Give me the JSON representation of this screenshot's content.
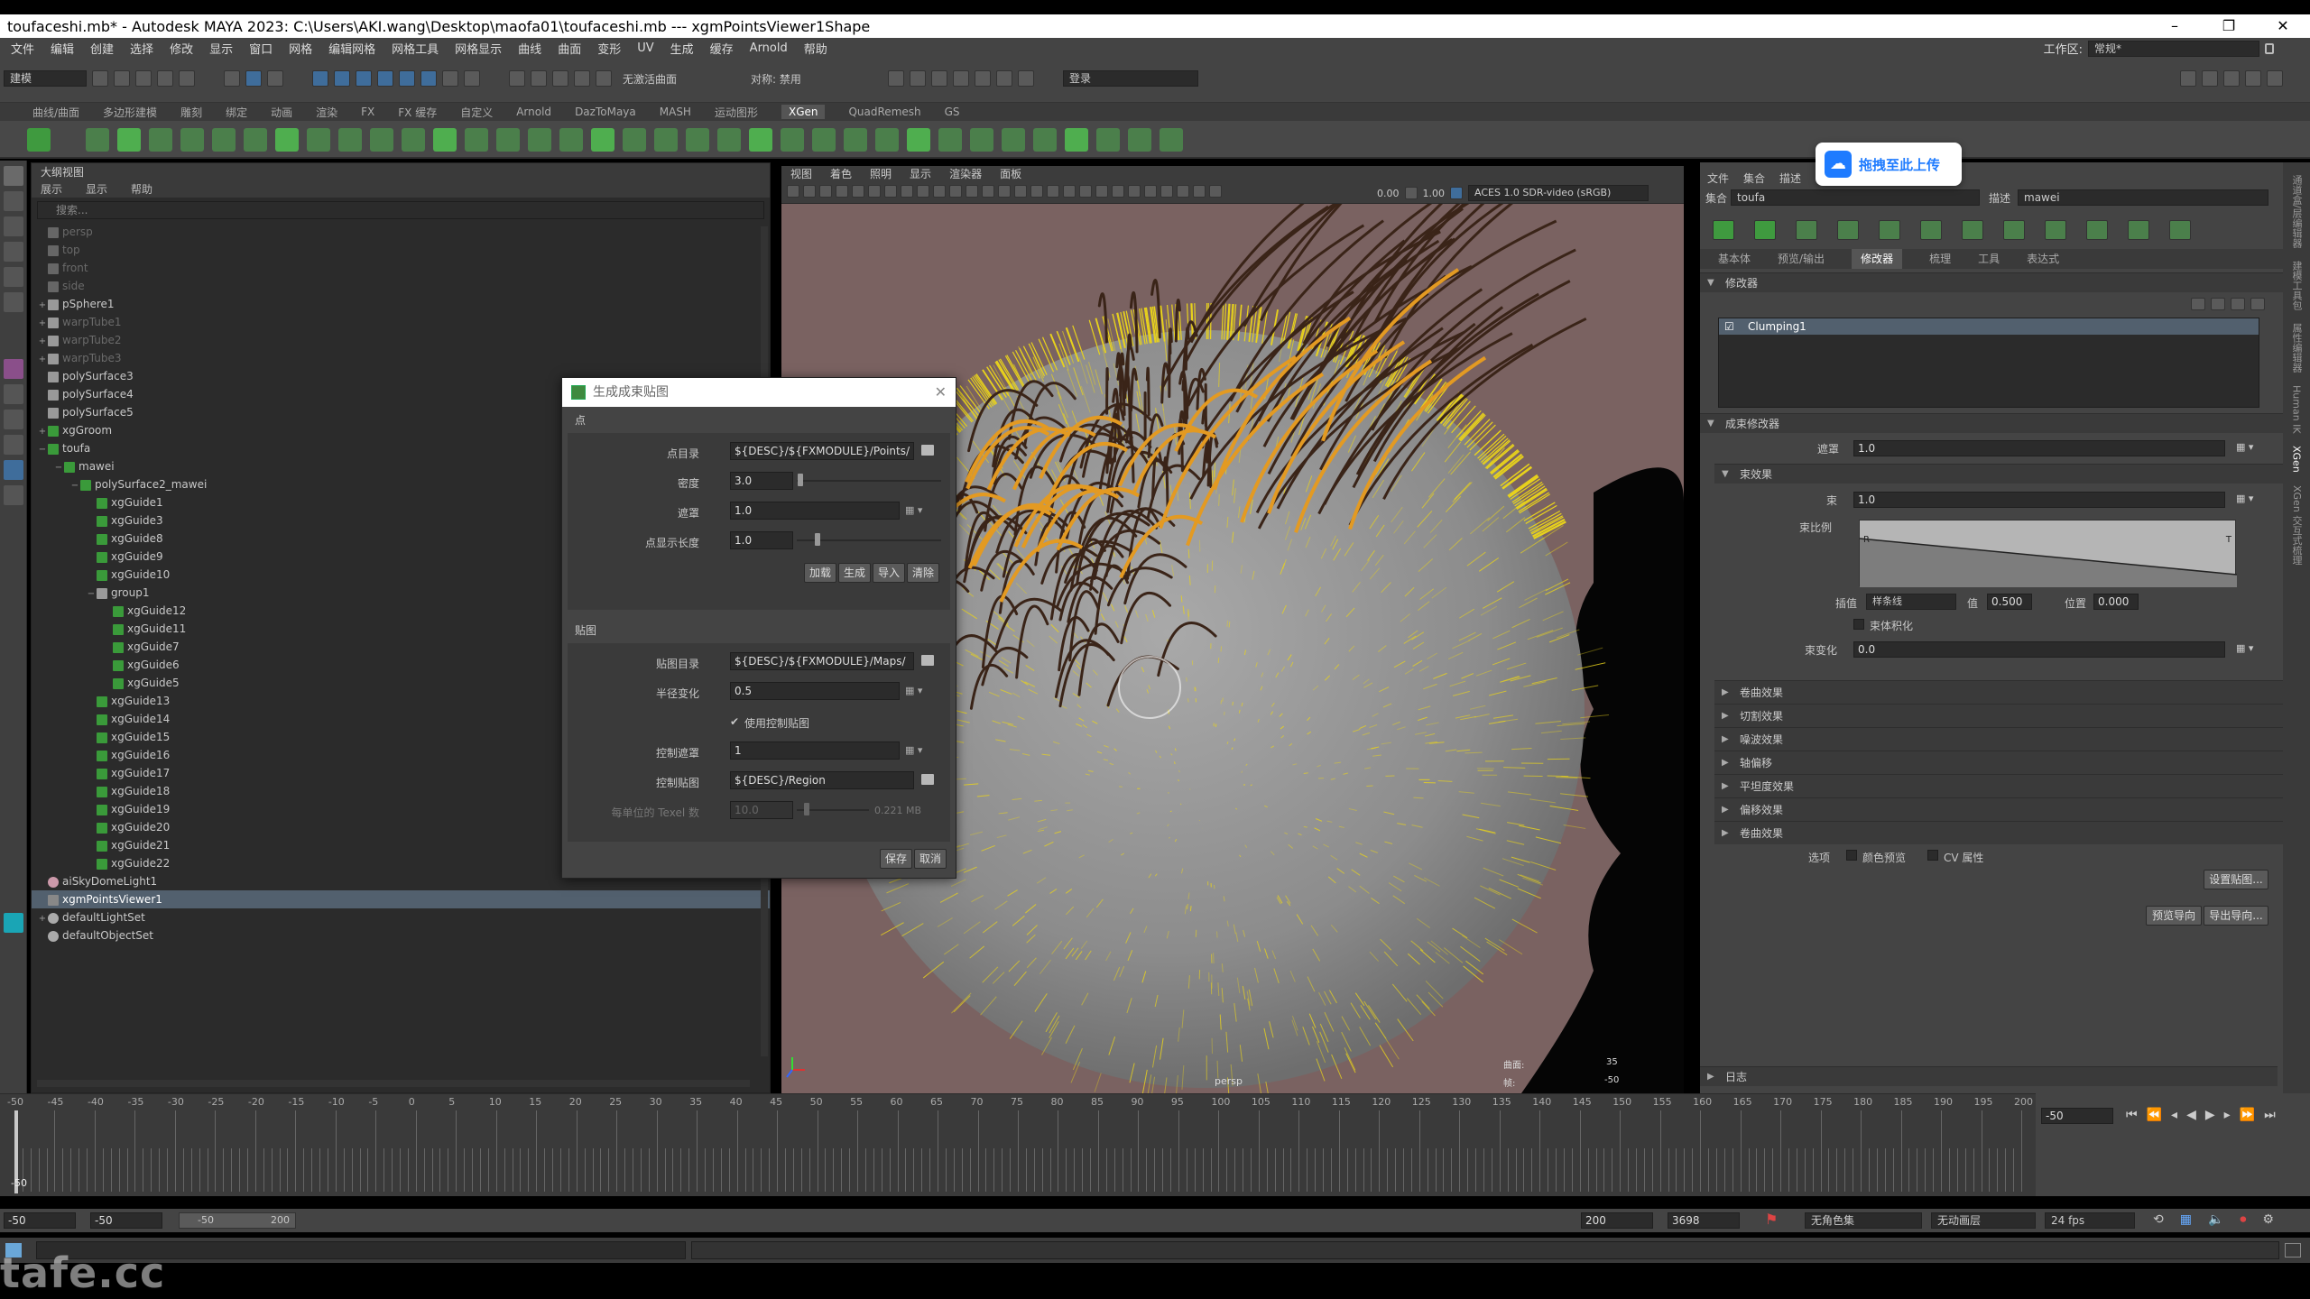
{
  "window": {
    "title": "toufaceshi.mb* - Autodesk MAYA 2023: C:\\Users\\AKI.wang\\Desktop\\maofa01\\toufaceshi.mb   ---   xgmPointsViewer1Shape",
    "minimize": "–",
    "maximize": "❐",
    "close": "✕"
  },
  "menubar": {
    "items": [
      "文件",
      "编辑",
      "创建",
      "选择",
      "修改",
      "显示",
      "窗口",
      "网格",
      "编辑网格",
      "网格工具",
      "网格显示",
      "曲线",
      "曲面",
      "变形",
      "UV",
      "生成",
      "缓存",
      "Arnold",
      "帮助"
    ],
    "workspace_label": "工作区:",
    "workspace_value": "常规*"
  },
  "statusline": {
    "mode": "建模",
    "no_live_surface": "无激活曲面",
    "symmetry": "对称: 禁用",
    "login": "登录"
  },
  "shelf": {
    "tabs": [
      "曲线/曲面",
      "多边形建模",
      "雕刻",
      "绑定",
      "动画",
      "渲染",
      "FX",
      "FX 缓存",
      "自定义",
      "Arnold",
      "DazToMaya",
      "MASH",
      "运动图形",
      "XGen",
      "QuadRemesh",
      "GS"
    ],
    "active_tab": "XGen"
  },
  "outliner": {
    "title": "大纲视图",
    "menu": [
      "展示",
      "显示",
      "帮助"
    ],
    "search_placeholder": "搜索...",
    "rows": [
      {
        "label": "persp",
        "indent": 1,
        "dim": true,
        "icon": "camera"
      },
      {
        "label": "top",
        "indent": 1,
        "dim": true,
        "icon": "camera"
      },
      {
        "label": "front",
        "indent": 1,
        "dim": true,
        "icon": "camera"
      },
      {
        "label": "side",
        "indent": 1,
        "dim": true,
        "icon": "camera"
      },
      {
        "label": "pSphere1",
        "indent": 1,
        "exp": "+",
        "icon": "mesh"
      },
      {
        "label": "warpTube1",
        "indent": 1,
        "exp": "+",
        "dim": true,
        "icon": "mesh"
      },
      {
        "label": "warpTube2",
        "indent": 1,
        "exp": "+",
        "dim": true,
        "icon": "mesh"
      },
      {
        "label": "warpTube3",
        "indent": 1,
        "exp": "+",
        "dim": true,
        "icon": "mesh"
      },
      {
        "label": "polySurface3",
        "indent": 1,
        "icon": "mesh"
      },
      {
        "label": "polySurface4",
        "indent": 1,
        "icon": "mesh"
      },
      {
        "label": "polySurface5",
        "indent": 1,
        "icon": "mesh"
      },
      {
        "label": "xgGroom",
        "indent": 1,
        "exp": "+",
        "icon": "xgen"
      },
      {
        "label": "toufa",
        "indent": 1,
        "exp": "−",
        "icon": "xgen"
      },
      {
        "label": "mawei",
        "indent": 2,
        "exp": "−",
        "icon": "xgen"
      },
      {
        "label": "polySurface2_mawei",
        "indent": 3,
        "exp": "−",
        "icon": "grid"
      },
      {
        "label": "xgGuide1",
        "indent": 4,
        "icon": "guide"
      },
      {
        "label": "xgGuide3",
        "indent": 4,
        "icon": "guide"
      },
      {
        "label": "xgGuide8",
        "indent": 4,
        "icon": "guide"
      },
      {
        "label": "xgGuide9",
        "indent": 4,
        "icon": "guide"
      },
      {
        "label": "xgGuide10",
        "indent": 4,
        "icon": "guide"
      },
      {
        "label": "group1",
        "indent": 4,
        "exp": "−",
        "icon": "group"
      },
      {
        "label": "xgGuide12",
        "indent": 5,
        "icon": "guide"
      },
      {
        "label": "xgGuide11",
        "indent": 5,
        "icon": "guide"
      },
      {
        "label": "xgGuide7",
        "indent": 5,
        "icon": "guide"
      },
      {
        "label": "xgGuide6",
        "indent": 5,
        "icon": "guide"
      },
      {
        "label": "xgGuide5",
        "indent": 5,
        "icon": "guide"
      },
      {
        "label": "xgGuide13",
        "indent": 4,
        "icon": "guide"
      },
      {
        "label": "xgGuide14",
        "indent": 4,
        "icon": "guide"
      },
      {
        "label": "xgGuide15",
        "indent": 4,
        "icon": "guide"
      },
      {
        "label": "xgGuide16",
        "indent": 4,
        "icon": "guide"
      },
      {
        "label": "xgGuide17",
        "indent": 4,
        "icon": "guide"
      },
      {
        "label": "xgGuide18",
        "indent": 4,
        "icon": "guide"
      },
      {
        "label": "xgGuide19",
        "indent": 4,
        "icon": "guide"
      },
      {
        "label": "xgGuide20",
        "indent": 4,
        "icon": "guide"
      },
      {
        "label": "xgGuide21",
        "indent": 4,
        "icon": "guide"
      },
      {
        "label": "xgGuide22",
        "indent": 4,
        "icon": "guide"
      },
      {
        "label": "aiSkyDomeLight1",
        "indent": 1,
        "icon": "light"
      },
      {
        "label": "xgmPointsViewer1",
        "indent": 1,
        "selected": true,
        "icon": "points"
      },
      {
        "label": "defaultLightSet",
        "indent": 1,
        "exp": "+",
        "icon": "set"
      },
      {
        "label": "defaultObjectSet",
        "indent": 1,
        "icon": "set"
      }
    ]
  },
  "viewport": {
    "menu": [
      "视图",
      "着色",
      "照明",
      "显示",
      "渲染器",
      "面板"
    ],
    "exposure": "0.00",
    "gamma": "1.00",
    "color_space": "ACES 1.0 SDR-video (sRGB)",
    "camera_label": "persp",
    "hud_left_label": "曲面:",
    "hud_left_value": "35",
    "hud_right_label": "帧:",
    "hud_right_value": "-50"
  },
  "dialog": {
    "title": "生成成束贴图",
    "close": "✕",
    "points_section": "点",
    "maps_section": "贴图",
    "point_dir_label": "点目录",
    "point_dir_value": "${DESC}/${FXMODULE}/Points/",
    "density_label": "密度",
    "density_value": "3.0",
    "mask_label": "遮罩",
    "mask_value": "1.0",
    "point_display_label": "点显示长度",
    "point_display_value": "1.0",
    "btn_load": "加载",
    "btn_generate": "生成",
    "btn_import": "导入",
    "btn_clear": "清除",
    "map_dir_label": "贴图目录",
    "map_dir_value": "${DESC}/${FXMODULE}/Maps/",
    "radius_var_label": "半径变化",
    "radius_var_value": "0.5",
    "use_control_map": "使用控制贴图",
    "control_mask_label": "控制遮罩",
    "control_mask_value": "1",
    "control_map_label": "控制贴图",
    "control_map_value": "${DESC}/Region",
    "texel_label": "每单位的 Texel 数",
    "texel_value": "10.0",
    "texel_size": "0.221 MB",
    "btn_save": "保存",
    "btn_cancel": "取消"
  },
  "upload": {
    "text": "拖拽至此上传"
  },
  "right_panel": {
    "menu": [
      "文件",
      "集合",
      "描述"
    ],
    "collection_label": "集合",
    "collection_value": "toufa",
    "description_label": "描述",
    "description_value": "mawei",
    "tabs": [
      "基本体",
      "预览/输出",
      "修改器",
      "梳理",
      "工具",
      "表达式"
    ],
    "active_tab": "修改器",
    "modifiers_header": "修改器",
    "modifier_item": "Clumping1",
    "clump_modifier_header": "成束修改器",
    "mask_label": "遮罩",
    "mask_value": "1.0",
    "clump_effect_header": "束效果",
    "clump_label": "束",
    "clump_value": "1.0",
    "clump_scale_label": "束比例",
    "interp_label": "插值",
    "interp_value": "样条线",
    "value_label": "值",
    "value_value": "0.500",
    "position_label": "位置",
    "position_value": "0.000",
    "flatten_label": "束体积化",
    "clump_var_label": "束变化",
    "clump_var_value": "0.0",
    "collapsed_sections": [
      "卷曲效果",
      "切割效果",
      "噪波效果",
      "轴偏移",
      "平坦度效果",
      "偏移效果",
      "卷曲效果"
    ],
    "options_label": "选项",
    "color_preview": "颜色预览",
    "cv_attr": "CV 属性",
    "setup_maps_btn": "设置贴图...",
    "preview_guide_btn": "预览导向",
    "export_guide_btn": "导出导向...",
    "log_header": "日志"
  },
  "vertical_tabs": [
    "通道盒/层编辑器",
    "建模工具包",
    "属性编辑器",
    "Human IK",
    "XGen",
    "XGen 交互式梳理"
  ],
  "timeline": {
    "ticks": [
      "-50",
      "-45",
      "-40",
      "-35",
      "-30",
      "-25",
      "-20",
      "-15",
      "-10",
      "-5",
      "0",
      "5",
      "10",
      "15",
      "20",
      "25",
      "30",
      "35",
      "40",
      "45",
      "50",
      "55",
      "60",
      "65",
      "70",
      "75",
      "80",
      "85",
      "90",
      "95",
      "100",
      "105",
      "110",
      "115",
      "120",
      "125",
      "130",
      "135",
      "140",
      "145",
      "150",
      "155",
      "160",
      "165",
      "170",
      "175",
      "180",
      "185",
      "190",
      "195",
      "200"
    ],
    "current_frame": "-50",
    "current_frame_field": "-50"
  },
  "range": {
    "start": "-50",
    "anim_start": "-50",
    "range_min": "-50",
    "range_max": "200",
    "anim_end": "200",
    "end": "3698",
    "char_set": "无角色集",
    "anim_layer": "无动画层",
    "fps": "24 fps"
  },
  "watermark": "tafe.cc",
  "colors": {
    "guide_orange": "#e39a22",
    "hair_brown": "#3a2418",
    "points_yellow": "#e8d21c",
    "viewport_bg": "#7a6261",
    "selection_blue": "#52606e"
  }
}
